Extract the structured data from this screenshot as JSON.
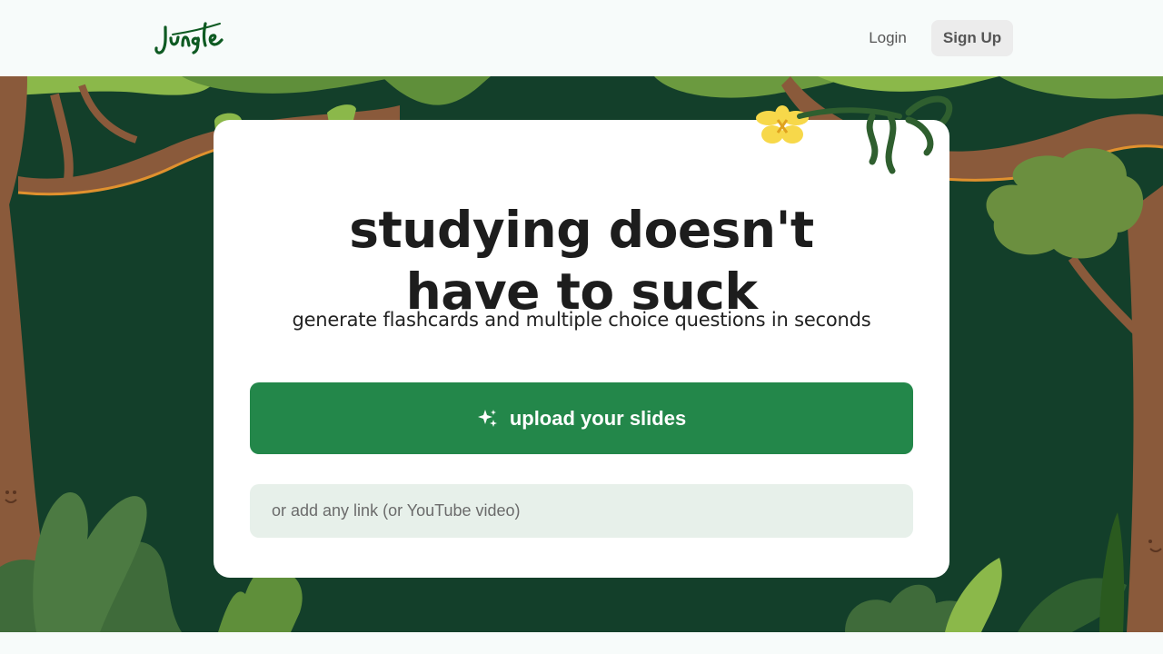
{
  "header": {
    "logo_text": "Jungle",
    "login_label": "Login",
    "signup_label": "Sign Up"
  },
  "hero": {
    "headline_line1": "studying doesn't",
    "headline_line2": "have to suck",
    "subtitle": "generate flashcards and multiple choice questions in seconds",
    "upload_label": "upload your slides",
    "upload_icon": "sparkles-icon",
    "link_placeholder": "or add any link (or YouTube video)"
  },
  "colors": {
    "hero_bg": "#133f2a",
    "primary_button": "#23874a",
    "input_bg": "#e7f0ea",
    "logo": "#0e5a22"
  }
}
